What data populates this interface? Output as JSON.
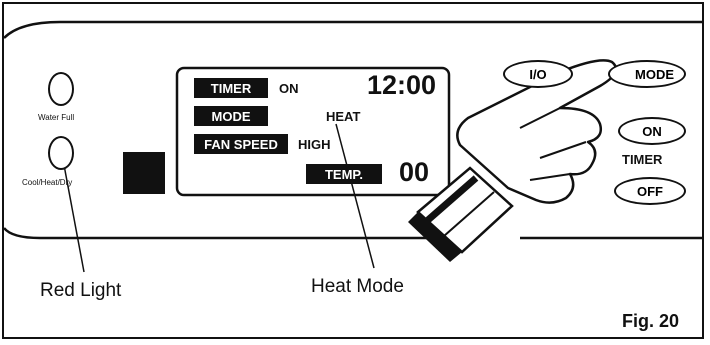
{
  "left_panel": {
    "indicator_top_label": "Water Full",
    "indicator_bottom_label": "Cool/Heat/Dry"
  },
  "display": {
    "timer_tag": "TIMER",
    "timer_state": "ON",
    "clock": "12:00",
    "mode_tag": "MODE",
    "mode_value": "HEAT",
    "fan_tag": "FAN SPEED",
    "fan_value": "HIGH",
    "temp_tag": "TEMP.",
    "temp_value": "00"
  },
  "buttons": {
    "power": "I/O",
    "mode": "MODE",
    "timer_on": "ON",
    "timer_label": "TIMER",
    "timer_off": "OFF"
  },
  "callouts": {
    "red_light": "Red Light",
    "heat_mode": "Heat Mode"
  },
  "figure_label": "Fig. 20"
}
